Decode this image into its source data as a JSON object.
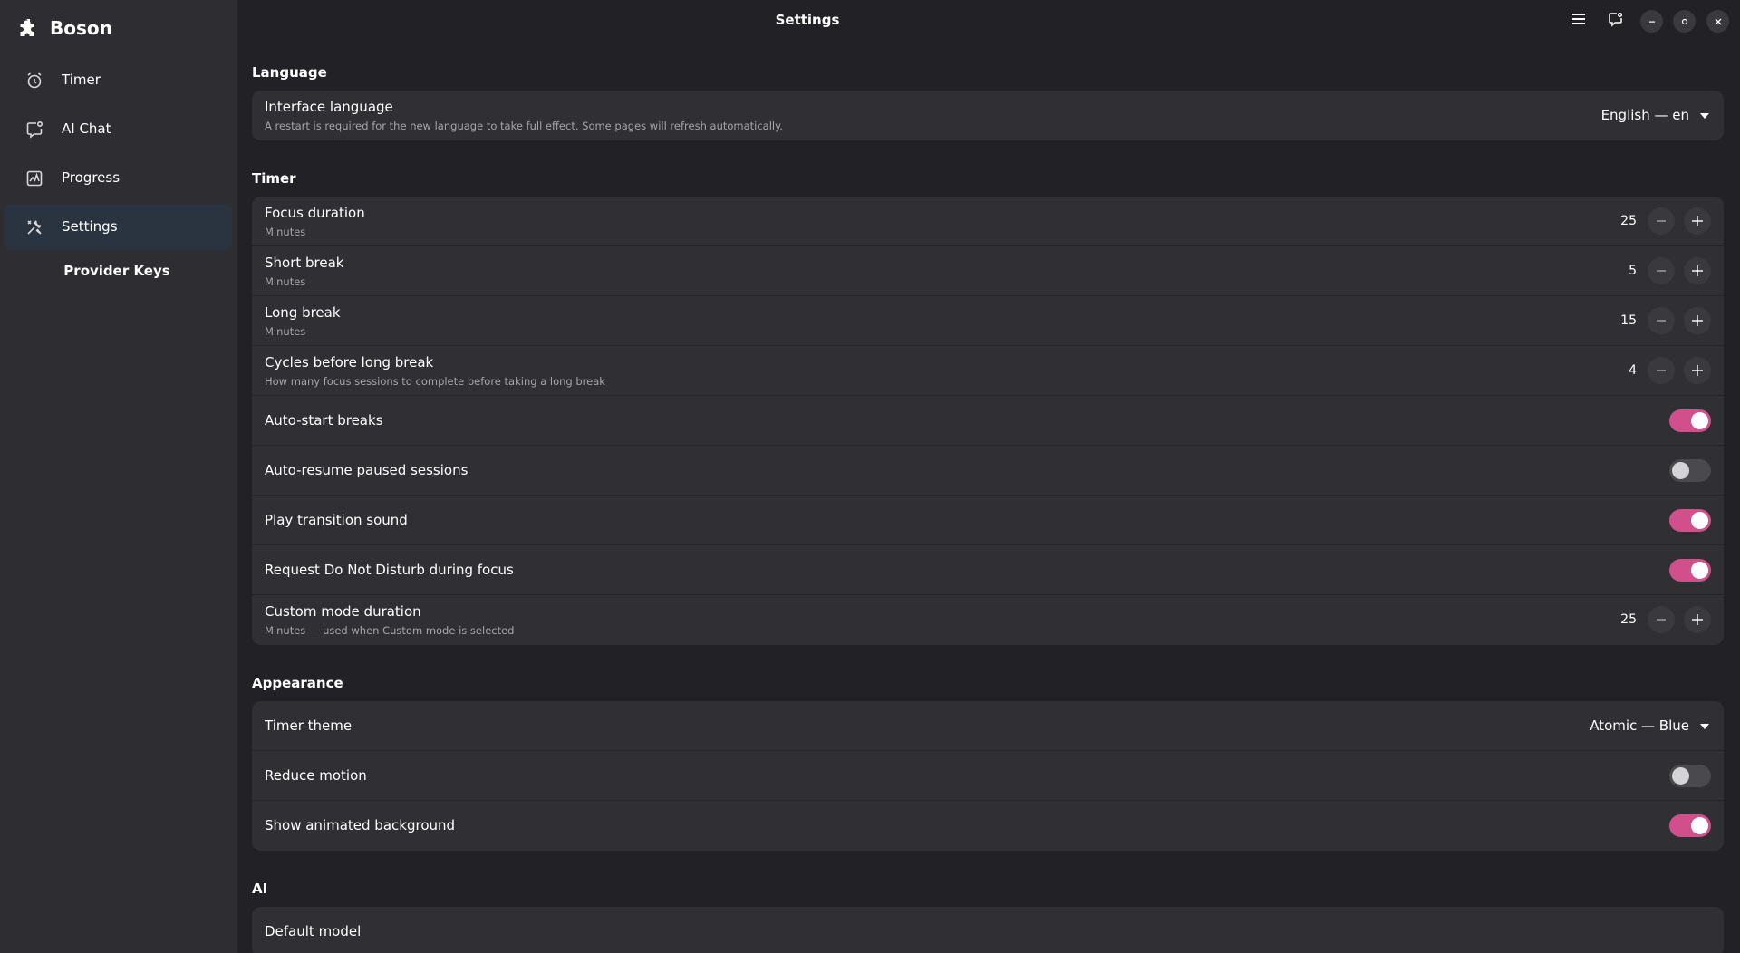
{
  "app": {
    "name": "Boson"
  },
  "header": {
    "title": "Settings"
  },
  "sidebar": {
    "items": [
      {
        "label": "Timer",
        "icon": "alarm-clock-icon"
      },
      {
        "label": "AI Chat",
        "icon": "chat-bubble-icon"
      },
      {
        "label": "Progress",
        "icon": "chart-icon"
      },
      {
        "label": "Settings",
        "icon": "tools-icon",
        "active": true
      }
    ],
    "sub_item": "Provider Keys"
  },
  "sections": {
    "language": {
      "title": "Language",
      "interface_language": {
        "title": "Interface language",
        "subtitle": "A restart is required for the new language to take full effect. Some pages will refresh automatically.",
        "value": "English — en"
      }
    },
    "timer": {
      "title": "Timer",
      "focus_duration": {
        "title": "Focus duration",
        "subtitle": "Minutes",
        "value": "25"
      },
      "short_break": {
        "title": "Short break",
        "subtitle": "Minutes",
        "value": "5"
      },
      "long_break": {
        "title": "Long break",
        "subtitle": "Minutes",
        "value": "15"
      },
      "cycles": {
        "title": "Cycles before long break",
        "subtitle": "How many focus sessions to complete before taking a long break",
        "value": "4"
      },
      "auto_start_breaks": {
        "title": "Auto-start breaks",
        "on": true
      },
      "auto_resume": {
        "title": "Auto-resume paused sessions",
        "on": false
      },
      "play_sound": {
        "title": "Play transition sound",
        "on": true
      },
      "dnd": {
        "title": "Request Do Not Disturb during focus",
        "on": true
      },
      "custom_duration": {
        "title": "Custom mode duration",
        "subtitle": "Minutes — used when Custom mode is selected",
        "value": "25"
      }
    },
    "appearance": {
      "title": "Appearance",
      "timer_theme": {
        "title": "Timer theme",
        "value": "Atomic — Blue"
      },
      "reduce_motion": {
        "title": "Reduce motion",
        "on": false
      },
      "animated_bg": {
        "title": "Show animated background",
        "on": true
      }
    },
    "ai": {
      "title": "AI",
      "default_model": {
        "title": "Default model"
      }
    }
  },
  "colors": {
    "accent": "#d14f8a",
    "background": "#222226",
    "sidebar": "#2e2e32",
    "card": "#303034",
    "active_nav": "#2a3440"
  }
}
